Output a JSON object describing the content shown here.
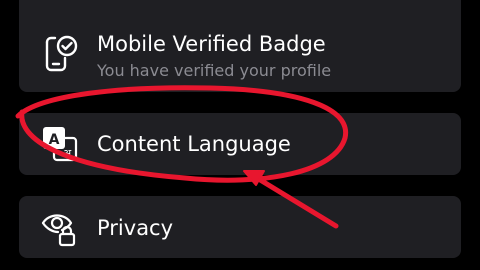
{
  "items": [
    {
      "title": "Mobile Verified Badge",
      "subtitle": "You have verified your profile",
      "icon": "mobile-verified-icon"
    },
    {
      "title": "Content Language",
      "icon": "language-icon",
      "glyph_latin": "A",
      "glyph_devanagari": "अ"
    },
    {
      "title": "Privacy",
      "icon": "privacy-eye-lock-icon"
    }
  ],
  "colors": {
    "background": "#000000",
    "card": "#1f1f23",
    "text": "#ffffff",
    "subtext": "#8b8b92",
    "annotation": "#e8162e"
  }
}
